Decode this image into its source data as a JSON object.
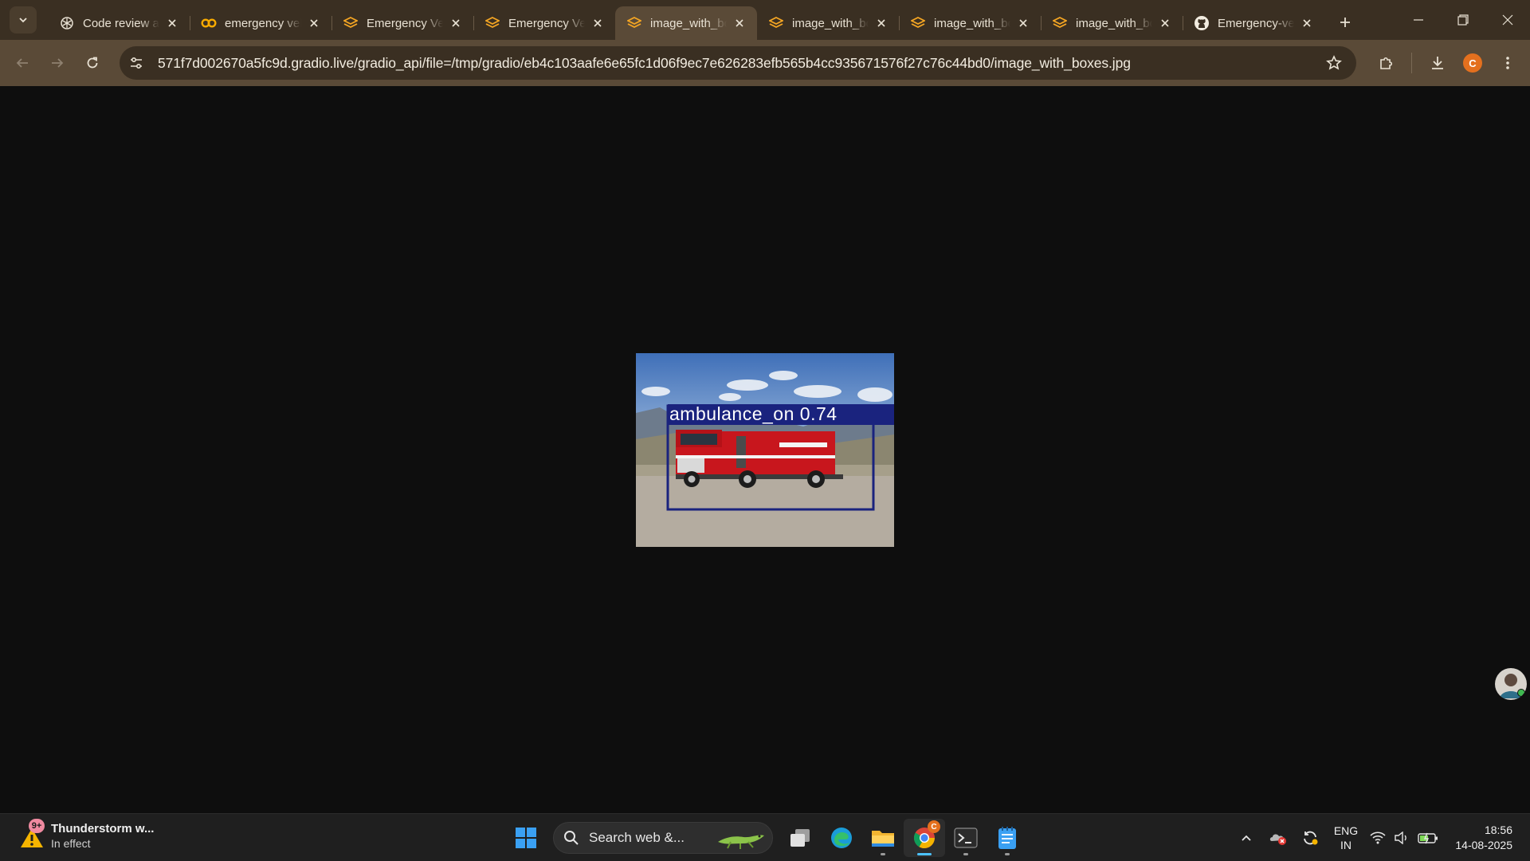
{
  "tabstrip": {
    "tabs": [
      {
        "title": "Code review assistant",
        "icon": "chatgpt-icon"
      },
      {
        "title": "emergency vehicle detection",
        "icon": "colab-icon"
      },
      {
        "title": "Emergency Vehicle Detection",
        "icon": "gradio-icon"
      },
      {
        "title": "Emergency Vehicle Detection",
        "icon": "gradio-icon"
      },
      {
        "title": "image_with_boxes.jpg",
        "icon": "gradio-icon",
        "active": true
      },
      {
        "title": "image_with_boxes.jpg",
        "icon": "gradio-icon"
      },
      {
        "title": "image_with_boxes.jpg",
        "icon": "gradio-icon"
      },
      {
        "title": "image_with_boxes.jpg",
        "icon": "gradio-icon"
      },
      {
        "title": "Emergency-vehicle-detection",
        "icon": "github-icon"
      }
    ]
  },
  "toolbar": {
    "url": "571f7d002670a5fc9d.gradio.live/gradio_api/file=/tmp/gradio/eb4c103aafe6e65fc1d06f9ec7e626283efb565b4cc935671576f27c76c44bd0/image_with_boxes.jpg",
    "profile_initial": "C"
  },
  "viewer": {
    "detection_label": "ambulance_on 0.74"
  },
  "taskbar": {
    "weather_title": "Thunderstorm w...",
    "weather_subtitle": "In effect",
    "weather_badge": "9+",
    "search_placeholder": "Search web &...",
    "chrome_badge": "C",
    "lang_line1": "ENG",
    "lang_line2": "IN",
    "time": "18:56",
    "date": "14-08-2025"
  },
  "colors": {
    "tabstrip_bg": "#3a2f22",
    "toolbar_bg": "#5a4a37",
    "page_bg": "#0e0e0e",
    "taskbar_bg": "#1f1f1f",
    "gradio_orange": "#f5a623",
    "detection_box": "#1a237e"
  }
}
